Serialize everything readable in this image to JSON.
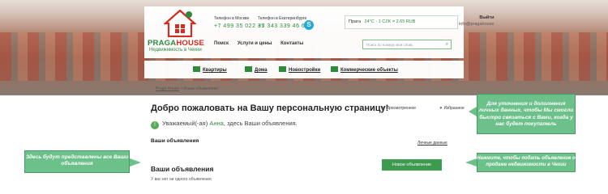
{
  "header": {
    "brand_a": "PRAGA",
    "brand_b": "HOUSE",
    "tagline": "Недвижимость в Чехии",
    "phones": [
      {
        "label": "Телефон в Москве",
        "number": "+7 499 35 022 35"
      },
      {
        "label": "Телефон в Екатеринбурге",
        "number": "+7 343 339 46 63"
      }
    ],
    "topnav": [
      "Поиск",
      "Услуги и цены",
      "Контакты"
    ],
    "city": "Прага",
    "weather": "24°C · 1 CZK = 2.65 RUB",
    "logout": "Выйти",
    "email": "info@pragahouse",
    "search_placeholder": "Поиск по номеру или слову"
  },
  "categories": [
    "Квартиры",
    "Дома",
    "Новостройки",
    "Коммерческие объекты"
  ],
  "breadcrumb": [
    "Praga House",
    " > Ваши объявления"
  ],
  "main": {
    "title": "Добро пожаловать на Вашу персональную страницу!",
    "viewed": "Просмотренное",
    "favorites": "Избранное",
    "greet_prefix": "Уважаемый(-ая)",
    "user_name": "Анна",
    "greet_suffix": ", здесь Ваши объявления.",
    "section": "Ваши объявления",
    "personal_link": "Личные данные",
    "ads_title": "Ваши объявления",
    "ads_empty": "У вас нет ни одного объявления",
    "new_ad": "Новое объявление"
  },
  "notes": {
    "top": "Для уточнения и дополнения личных данных, чтобы  Мы смогли быстро связаться с Вами, когда у нас будет покупатель",
    "right": "Нажмите, чтобы подать объявление о продаже недвижимости в Чехии",
    "left": "Здесь будут представлены все Ваши объявления"
  },
  "colors": {
    "accent": "#2e8b3c",
    "brand_red": "#d62b1f",
    "note": "#6cc08a"
  }
}
